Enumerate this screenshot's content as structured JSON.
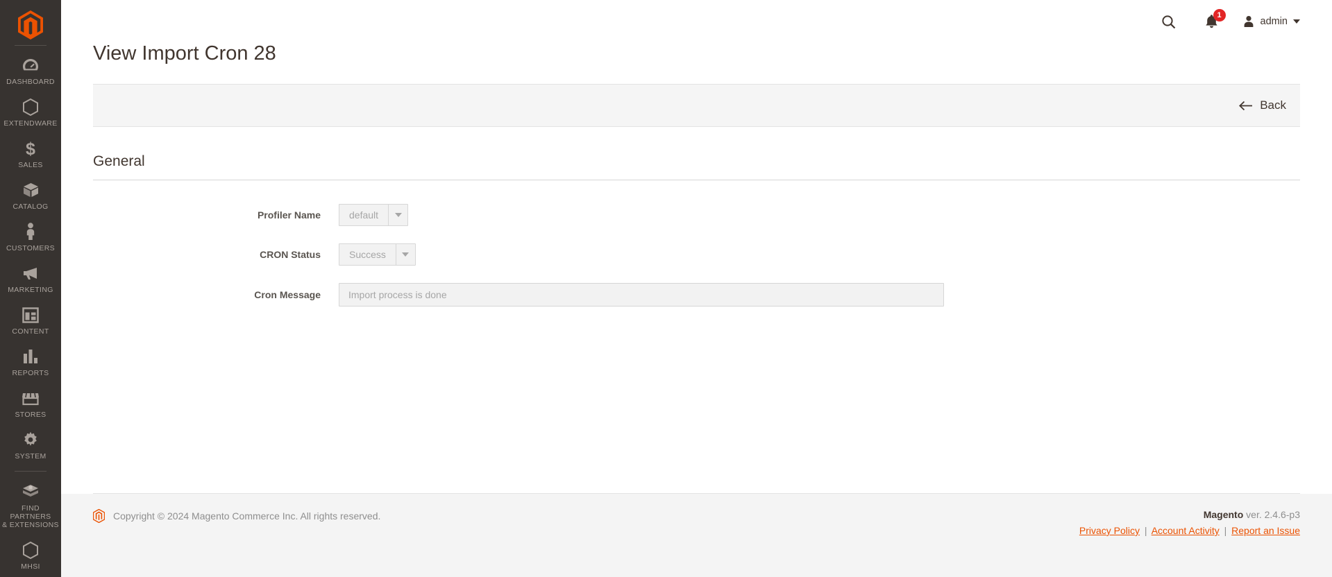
{
  "brand": {
    "logo_name": "magento-logo",
    "accent": "#eb5202",
    "sidebar_bg": "#373330"
  },
  "sidebar": {
    "items": [
      {
        "icon": "dashboard-icon",
        "label": "DASHBOARD"
      },
      {
        "icon": "hexagon-icon",
        "label": "EXTENDWARE"
      },
      {
        "icon": "dollar-icon",
        "label": "SALES"
      },
      {
        "icon": "box-icon",
        "label": "CATALOG"
      },
      {
        "icon": "person-icon",
        "label": "CUSTOMERS"
      },
      {
        "icon": "megaphone-icon",
        "label": "MARKETING"
      },
      {
        "icon": "layout-icon",
        "label": "CONTENT"
      },
      {
        "icon": "bar-chart-icon",
        "label": "REPORTS"
      },
      {
        "icon": "store-icon",
        "label": "STORES"
      },
      {
        "icon": "gear-icon",
        "label": "SYSTEM"
      },
      {
        "icon": "extensions-icon",
        "label": "FIND PARTNERS\n& EXTENSIONS"
      },
      {
        "icon": "hexagon-icon",
        "label": "MHSI"
      }
    ],
    "find_partners_line1": "FIND PARTNERS",
    "find_partners_line2": "& EXTENSIONS"
  },
  "header": {
    "title": "View Import Cron 28",
    "search_icon": "search-icon",
    "notifications_icon": "bell-icon",
    "notifications_count": "1",
    "user_icon": "user-avatar-icon",
    "user_name": "admin"
  },
  "page_actions": {
    "back_label": "Back",
    "back_icon": "arrow-left-icon"
  },
  "general": {
    "section_title": "General",
    "fields": {
      "profiler_name": {
        "label": "Profiler Name",
        "value": "default"
      },
      "cron_status": {
        "label": "CRON Status",
        "value": "Success"
      },
      "cron_message": {
        "label": "Cron Message",
        "value": "Import process is done"
      }
    }
  },
  "footer": {
    "copyright": "Copyright © 2024 Magento Commerce Inc. All rights reserved.",
    "version": "ver. 2.4.6-p3",
    "version_brand": "Magento",
    "links": {
      "privacy": "Privacy Policy",
      "account": "Account Activity",
      "report": "Report an Issue",
      "separator": "|"
    }
  }
}
